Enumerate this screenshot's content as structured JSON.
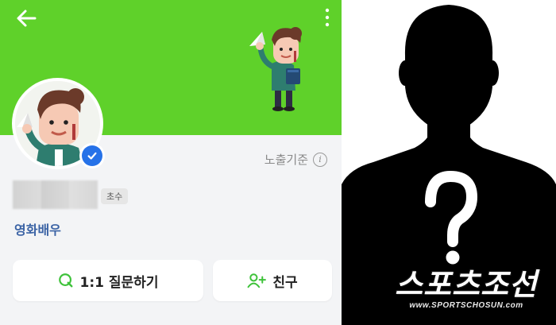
{
  "profile": {
    "exposure_label": "노출기준",
    "info_icon_glyph": "i",
    "badge": "초수",
    "occupation": "영화배우",
    "accent_green": "#5fd12a",
    "verified_color": "#2672e8"
  },
  "actions": {
    "ask_label": "1:1 질문하기",
    "friend_label": "친구"
  },
  "watermark": {
    "main": "스포츠조선",
    "sub": "www.SPORTSCHOSUN.com"
  },
  "icons": {
    "back": "arrow-left-icon",
    "more": "more-vertical-icon",
    "verified": "verified-check-icon",
    "ask": "question-q-icon",
    "friend": "add-friend-icon",
    "question_mark": "question-mark-icon"
  }
}
